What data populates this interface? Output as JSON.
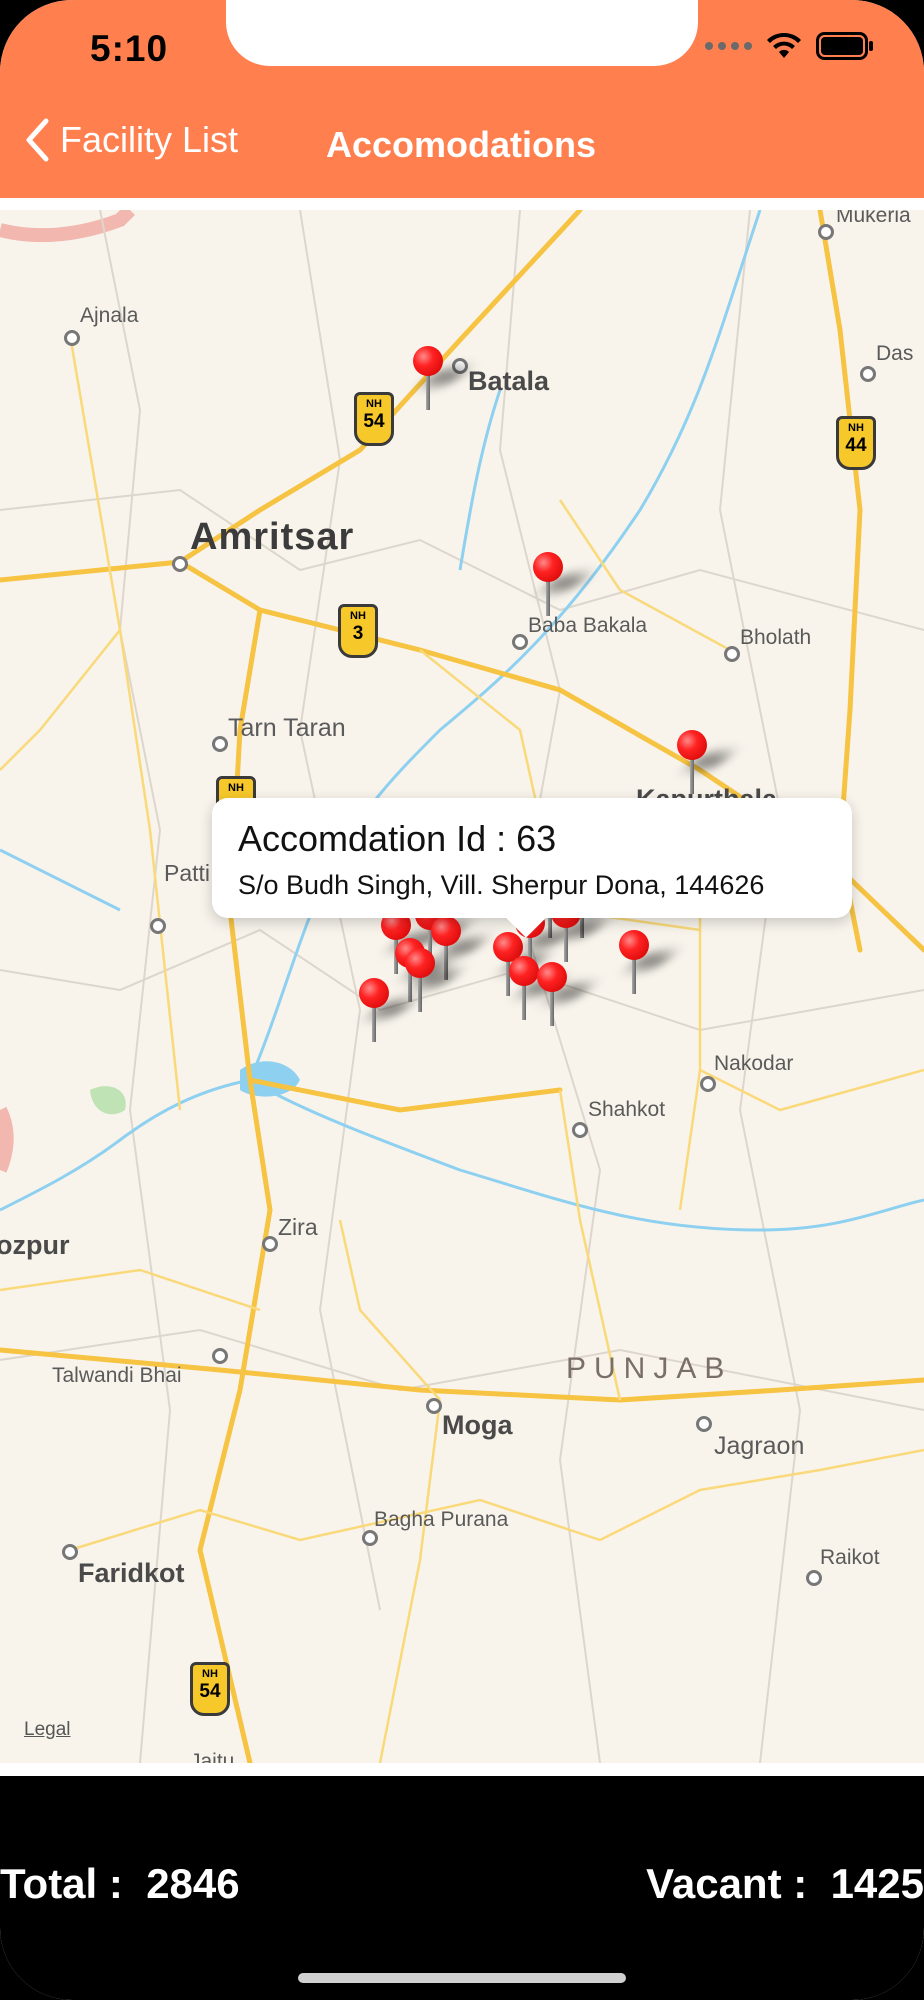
{
  "status_bar": {
    "time": "5:10"
  },
  "nav": {
    "back_label": "Facility List",
    "title": "Accomodations"
  },
  "map": {
    "labels": {
      "mukerian": "Mukeria",
      "ajnala": "Ajnala",
      "batala": "Batala",
      "dasuya": "Das",
      "amritsar": "Amritsar",
      "baba_bakala": "Baba Bakala",
      "bholath": "Bholath",
      "tarn_taran": "Tarn Taran",
      "kapurthala": "Kapurthala",
      "patti": "Patti",
      "nakodar": "Nakodar",
      "shahkot": "Shahkot",
      "zira": "Zira",
      "ferozpur": "ozpur",
      "talwandi_bhai": "Talwandi Bhai",
      "punjab": "PUNJAB",
      "moga": "Moga",
      "jagraon": "Jagraon",
      "bagha_purana": "Bagha Purana",
      "raikot": "Raikot",
      "faridkot": "Faridkot",
      "jaitu": "Jaitu",
      "legal": "Legal"
    },
    "shields": {
      "nh54_top": {
        "prefix": "NH",
        "number": "54"
      },
      "nh44": {
        "prefix": "NH",
        "number": "44"
      },
      "nh3": {
        "prefix": "NH",
        "number": "3"
      },
      "nh_partial": {
        "prefix": "NH",
        "number": ""
      },
      "nh54_bottom": {
        "prefix": "NH",
        "number": "54"
      }
    },
    "callout": {
      "title": "Accomdation Id : 63",
      "address": "S/o Budh Singh, Vill. Sherpur Dona, 144626"
    }
  },
  "footer": {
    "total_text": "Total :  2846",
    "vacant_text": "Vacant :  1425"
  },
  "colors": {
    "header": "#FF7F4F",
    "map_background": "#F8F4EC",
    "road": "#F6C342",
    "river": "#8ED0F0",
    "pin": "#F22222"
  }
}
